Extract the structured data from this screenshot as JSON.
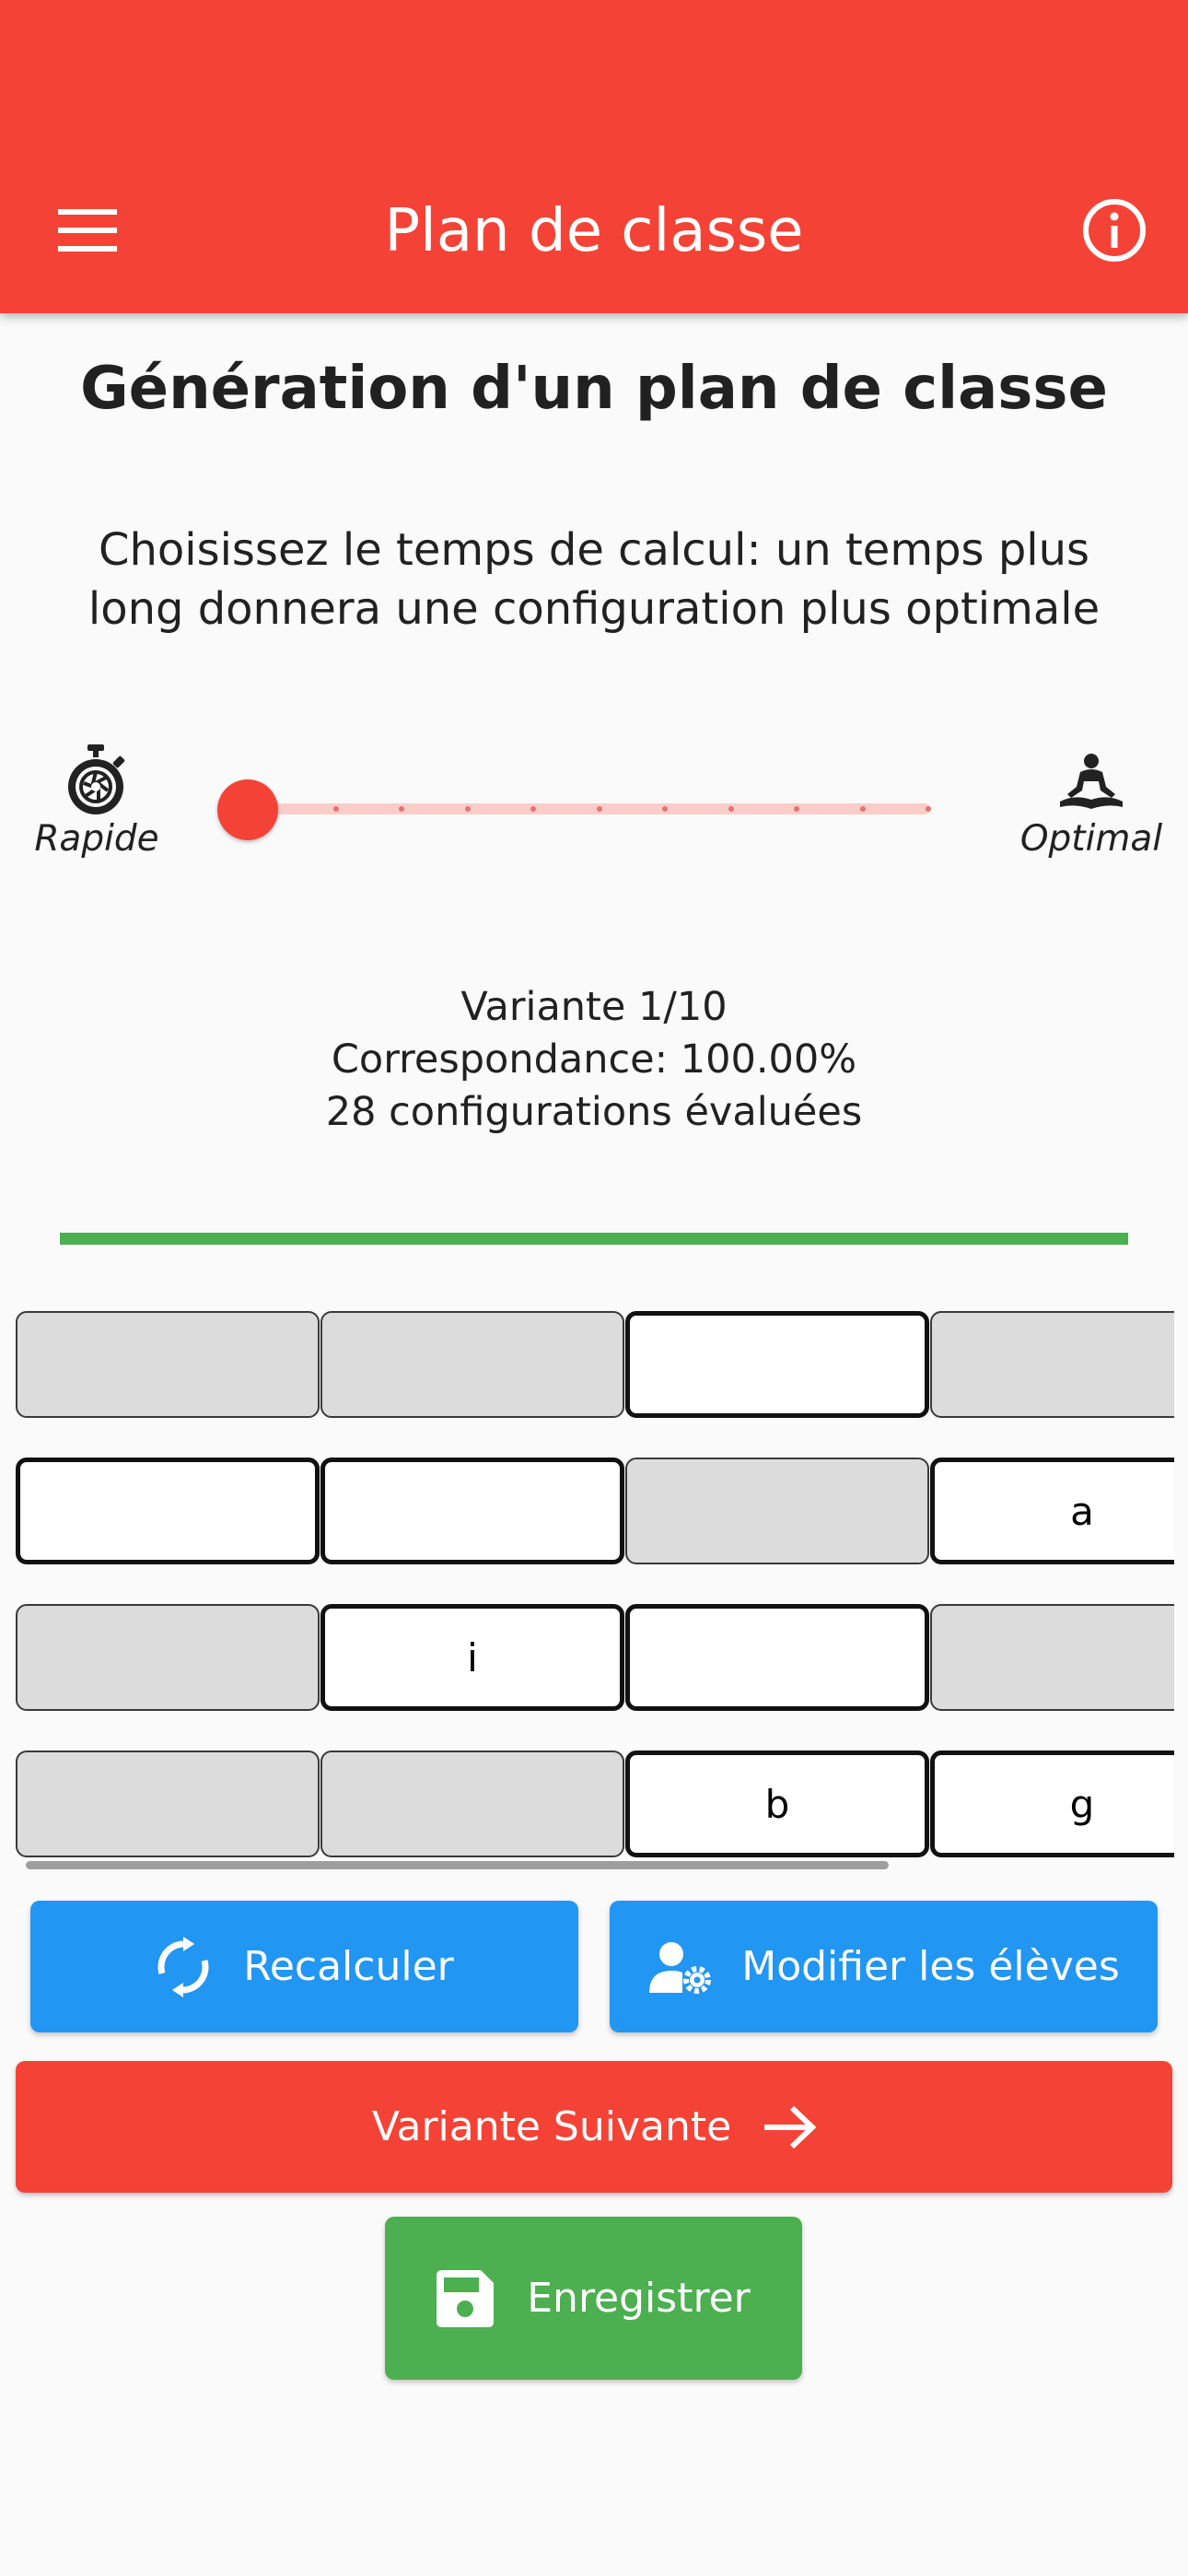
{
  "appbar": {
    "title": "Plan de classe",
    "menu_icon": "menu-icon",
    "info_icon": "info-icon",
    "color": "#f44336"
  },
  "heading": "Génération d'un plan de classe",
  "subtitle_line1": "Choisissez le temps de calcul: un temps plus",
  "subtitle_line2": "long donnera une configuration plus optimale",
  "slider": {
    "left_label": "Rapide",
    "right_label": "Optimal",
    "left_icon": "stopwatch-icon",
    "right_icon": "meditation-icon",
    "divisions": 11,
    "value_index": 0
  },
  "stats": {
    "variant": "Variante 1/10",
    "match": "Correspondance: 100.00%",
    "evaluated": "28 configurations évaluées"
  },
  "progress": {
    "value": 1.0,
    "color": "#4caf50"
  },
  "seating": {
    "rows": [
      [
        {
          "label": "",
          "filled": false
        },
        {
          "label": "",
          "filled": false
        },
        {
          "label": "",
          "filled": true
        },
        {
          "label": "",
          "filled": false
        }
      ],
      [
        {
          "label": "",
          "filled": true
        },
        {
          "label": "",
          "filled": true
        },
        {
          "label": "",
          "filled": false
        },
        {
          "label": "a",
          "filled": true
        }
      ],
      [
        {
          "label": "",
          "filled": false
        },
        {
          "label": "i",
          "filled": true
        },
        {
          "label": "",
          "filled": true
        },
        {
          "label": "",
          "filled": false
        }
      ],
      [
        {
          "label": "",
          "filled": false
        },
        {
          "label": "",
          "filled": false
        },
        {
          "label": "b",
          "filled": true
        },
        {
          "label": "g",
          "filled": true
        }
      ]
    ]
  },
  "buttons": {
    "recalculate": "Recalculer",
    "edit_students": "Modifier les élèves",
    "next_variant": "Variante Suivante",
    "save": "Enregistrer"
  }
}
